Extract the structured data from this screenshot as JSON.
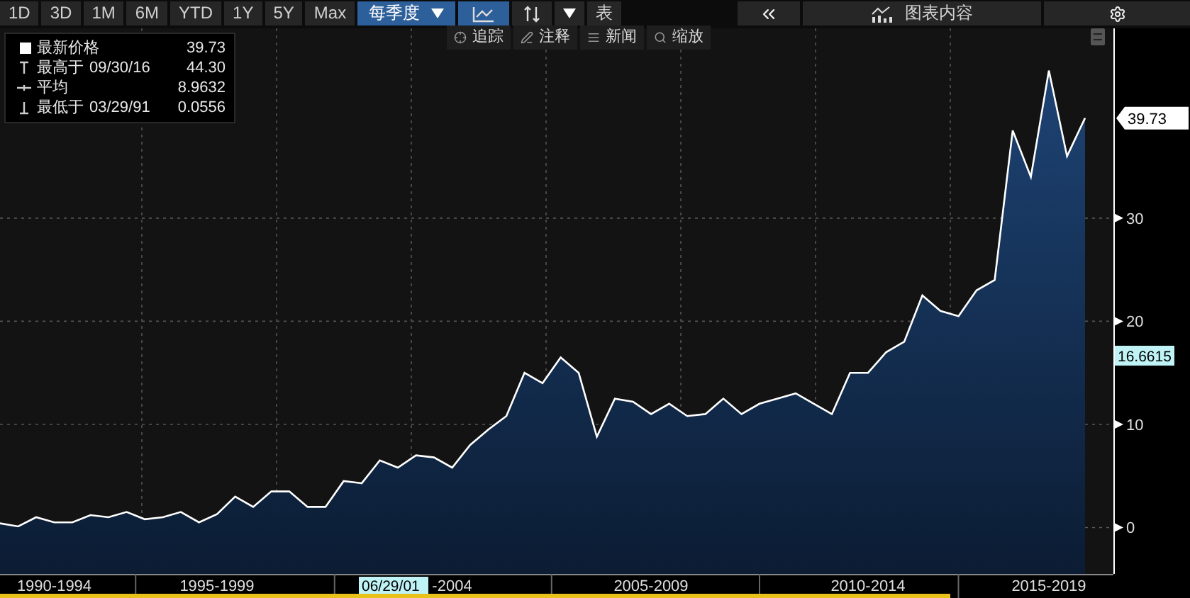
{
  "toolbar": {
    "ranges": [
      {
        "label": "1D",
        "selected": false
      },
      {
        "label": "3D",
        "selected": false
      },
      {
        "label": "1M",
        "selected": false
      },
      {
        "label": "6M",
        "selected": false
      },
      {
        "label": "YTD",
        "selected": false
      },
      {
        "label": "1Y",
        "selected": false
      },
      {
        "label": "5Y",
        "selected": false
      },
      {
        "label": "Max",
        "selected": false
      }
    ],
    "frequency": {
      "label": "每季度",
      "selected": true
    },
    "chart_type_selected": true,
    "table_label": "表",
    "panel_label": "图表内容"
  },
  "tools": [
    "追踪",
    "注释",
    "新闻",
    "缩放"
  ],
  "legend": [
    {
      "kind": "last",
      "label": "最新价格",
      "value": "39.73"
    },
    {
      "kind": "high",
      "label": "最高于",
      "date": "09/30/16",
      "value": "44.30"
    },
    {
      "kind": "avg",
      "label": "平均",
      "value": "8.9632"
    },
    {
      "kind": "low",
      "label": "最低于",
      "date": "03/29/91",
      "value": "0.0556"
    }
  ],
  "last_price_tag": "39.73",
  "crosshair": {
    "value": "16.6615",
    "date": "06/29/01"
  },
  "chart": {
    "chart_data": {
      "type": "area",
      "grid": true,
      "ylim": [
        -4.5,
        48.4
      ],
      "yticks": [
        0,
        10,
        20,
        30
      ],
      "categories": [
        null,
        null,
        null,
        "1990-1994",
        null,
        null,
        null,
        null,
        null,
        null,
        null,
        null,
        "1995-1999",
        null,
        null,
        null,
        null,
        null,
        null,
        null,
        null,
        null,
        null,
        null,
        null,
        "-2004",
        null,
        null,
        null,
        null,
        null,
        null,
        null,
        null,
        null,
        null,
        "2005-2009",
        null,
        null,
        null,
        null,
        null,
        null,
        null,
        null,
        null,
        null,
        null,
        "2010-2014",
        null,
        null,
        null,
        null,
        null,
        null,
        null,
        null,
        null,
        "2015-2019",
        null,
        null
      ],
      "series": [
        {
          "color": "#ffffff",
          "values": [
            0.4,
            0.1,
            1.0,
            0.5,
            0.5,
            1.2,
            1.0,
            1.5,
            0.8,
            1.0,
            1.5,
            0.5,
            1.3,
            3.0,
            2.0,
            3.5,
            3.5,
            2.0,
            2.0,
            4.5,
            4.3,
            6.5,
            5.8,
            7.0,
            6.8,
            5.8,
            8.0,
            9.5,
            10.8,
            15.0,
            14.0,
            16.5,
            15.0,
            8.8,
            12.5,
            12.2,
            11.0,
            12.0,
            10.8,
            11.0,
            12.5,
            11.0,
            12.0,
            12.5,
            13.0,
            12.0,
            11.0,
            15.0,
            15.0,
            17.0,
            18.0,
            22.5,
            21.0,
            20.5,
            23.0,
            24.0,
            38.5,
            34.0,
            44.3,
            36.0,
            39.7
          ]
        }
      ]
    }
  }
}
